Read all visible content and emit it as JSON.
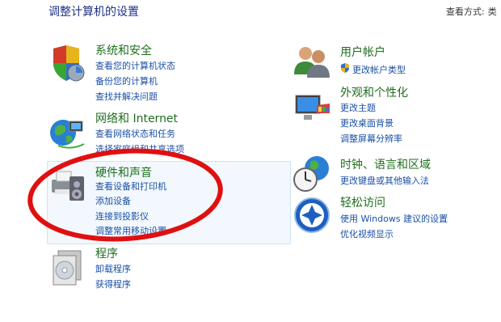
{
  "header": {
    "title": "调整计算机的设置",
    "view_by_label": "查看方式:",
    "view_by_value": "类"
  },
  "categories": {
    "system": {
      "title": "系统和安全",
      "icon": "shield-icon",
      "links": [
        "查看您的计算机状态",
        "备份您的计算机",
        "查找并解决问题"
      ]
    },
    "network": {
      "title": "网络和 Internet",
      "icon": "network-globe-icon",
      "links": [
        "查看网络状态和任务",
        "选择家庭组和共享选项"
      ]
    },
    "hardware": {
      "title": "硬件和声音",
      "icon": "printer-speaker-icon",
      "links": [
        "查看设备和打印机",
        "添加设备",
        "连接到投影仪",
        "调整常用移动设置"
      ]
    },
    "programs": {
      "title": "程序",
      "icon": "programs-disc-icon",
      "links": [
        "卸载程序",
        "获得程序"
      ]
    },
    "user": {
      "title": "用户帐户",
      "icon": "users-icon",
      "links": [
        "更改帐户类型"
      ]
    },
    "appearance": {
      "title": "外观和个性化",
      "icon": "monitor-paint-icon",
      "links": [
        "更改主题",
        "更改桌面背景",
        "调整屏幕分辨率"
      ]
    },
    "clock": {
      "title": "时钟、语言和区域",
      "icon": "clock-globe-icon",
      "links": [
        "更改键盘或其他输入法"
      ]
    },
    "ease": {
      "title": "轻松访问",
      "icon": "ease-of-access-icon",
      "links": [
        "使用 Windows 建议的设置",
        "优化视频显示"
      ]
    }
  },
  "colors": {
    "title": "#1e6e1e",
    "link": "#1a4fa8",
    "annotation": "#e01010"
  }
}
